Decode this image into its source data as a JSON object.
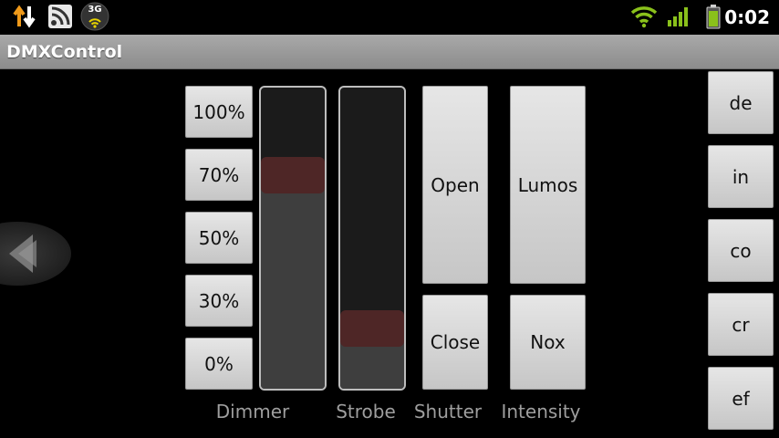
{
  "status_bar": {
    "icons": [
      "sync-icon",
      "rss-icon",
      "3g-signal-icon",
      "wifi-icon",
      "cell-signal-icon",
      "battery-icon"
    ],
    "network_label": "3G",
    "time": "0:02"
  },
  "app": {
    "title": "DMXControl"
  },
  "dimmer": {
    "presets": [
      "100%",
      "70%",
      "50%",
      "30%",
      "0%"
    ],
    "label": "Dimmer",
    "level": 0.71
  },
  "strobe": {
    "label": "Strobe",
    "level": 0.2
  },
  "shutter": {
    "open_label": "Open",
    "close_label": "Close",
    "label": "Shutter"
  },
  "intensity": {
    "lumos_label": "Lumos",
    "nox_label": "Nox",
    "label": "Intensity"
  },
  "side_buttons": [
    "de",
    "in",
    "co",
    "cr",
    "ef"
  ],
  "colors": {
    "slider_thumb": "#4e2626",
    "label_gray": "#9e9e9e",
    "title_bar": "#9a9a9a"
  }
}
